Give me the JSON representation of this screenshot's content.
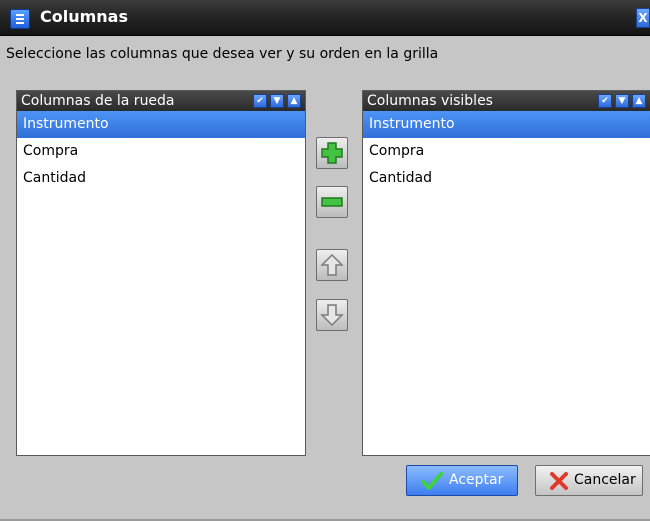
{
  "window": {
    "title": "Columnas",
    "close_label": "X"
  },
  "instructions": "Seleccione las columnas que desea ver y su orden en la grilla",
  "left_panel": {
    "header": "Columnas de la rueda",
    "items": [
      "Instrumento",
      "Compra",
      "Cantidad"
    ],
    "selected_index": 0
  },
  "right_panel": {
    "header": "Columnas visibles",
    "items": [
      "Instrumento",
      "Compra",
      "Cantidad"
    ],
    "selected_index": 0
  },
  "header_buttons": [
    "check-icon",
    "chevron-down-icon",
    "chevron-up-icon"
  ],
  "middle_buttons": [
    "add-icon",
    "remove-icon",
    "move-up-icon",
    "move-down-icon"
  ],
  "buttons": {
    "ok_label": "Aceptar",
    "cancel_label": "Cancelar"
  },
  "colors": {
    "accent": "#2f6fd8",
    "add_green": "#3cb83c",
    "cancel_red": "#d83a2a"
  }
}
